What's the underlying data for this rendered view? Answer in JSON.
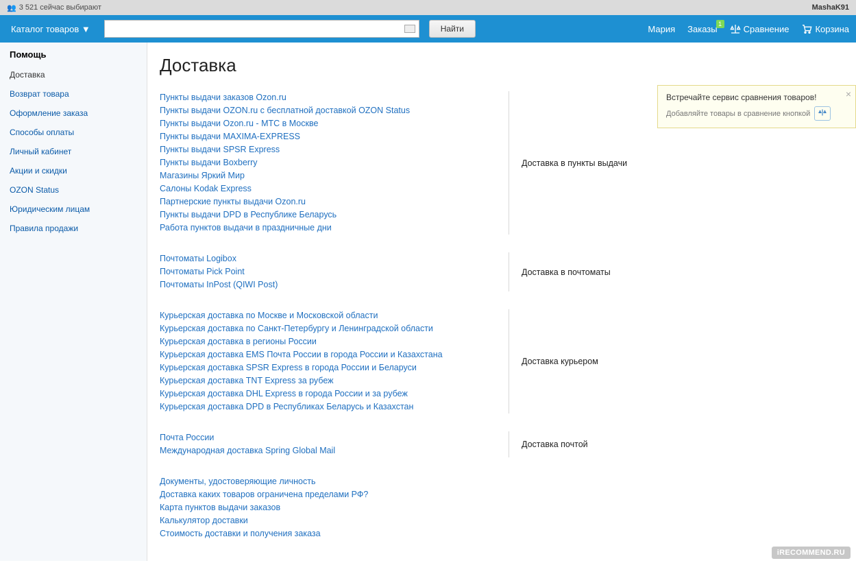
{
  "topstrip": {
    "viewers": "3 521 сейчас выбирают",
    "user": "MashaK91"
  },
  "nav": {
    "catalog": "Каталог товаров ▼",
    "find": "Найти",
    "user_link": "Мария",
    "orders": "Заказы",
    "orders_badge": "1",
    "compare": "Сравнение",
    "cart": "Корзина"
  },
  "sidebar": {
    "title": "Помощь",
    "items": [
      "Доставка",
      "Возврат товара",
      "Оформление заказа",
      "Способы оплаты",
      "Личный кабинет",
      "Акции и скидки",
      "OZON Status",
      "Юридическим лицам",
      "Правила продажи"
    ]
  },
  "page": {
    "title": "Доставка"
  },
  "sections": [
    {
      "label": "Доставка в пункты выдачи",
      "links": [
        "Пункты выдачи заказов Ozon.ru",
        "Пункты выдачи OZON.ru с бесплатной доставкой OZON Status",
        "Пункты выдачи Ozon.ru - МТС в Москве",
        "Пункты выдачи MAXIMA-EXPRESS",
        "Пункты выдачи SPSR Express",
        "Пункты выдачи Boxberry",
        "Магазины Яркий Мир",
        "Салоны Kodak Express",
        "Партнерские пункты выдачи Ozon.ru",
        "Пункты выдачи DPD в Республике Беларусь",
        "Работа пунктов выдачи в праздничные дни"
      ]
    },
    {
      "label": "Доставка в почтоматы",
      "links": [
        "Почтоматы Logibox",
        "Почтоматы Pick Point",
        "Почтоматы InPost (QIWI Post)"
      ]
    },
    {
      "label": "Доставка курьером",
      "links": [
        "Курьерская доставка по Москве и Московской области",
        "Курьерская доставка по Санкт-Петербургу и Ленинградской области",
        "Курьерская доставка в регионы России",
        "Курьерская доставка EMS Почта России в города России и Казахстана",
        "Курьерская доставка SPSR Express в города России и Беларуси",
        "Курьерская доставка TNT Express за рубеж",
        "Курьерская доставка DHL Express в города России и за рубеж",
        "Курьерская доставка DPD в Республиках Беларусь и Казахстан"
      ]
    },
    {
      "label": "Доставка почтой",
      "links": [
        "Почта России",
        "Международная доставка Spring Global Mail"
      ]
    }
  ],
  "extra_links": [
    "Документы, удостоверяющие личность",
    "Доставка каких товаров ограничена пределами РФ?",
    "Карта пунктов выдачи заказов",
    "Калькулятор доставки",
    "Стоимость доставки и получения заказа"
  ],
  "callout": {
    "title": "Встречайте сервис сравнения товаров!",
    "sub": "Добавляйте товары в сравнение кнопкой"
  },
  "watermark": "iRECOMMEND.RU"
}
